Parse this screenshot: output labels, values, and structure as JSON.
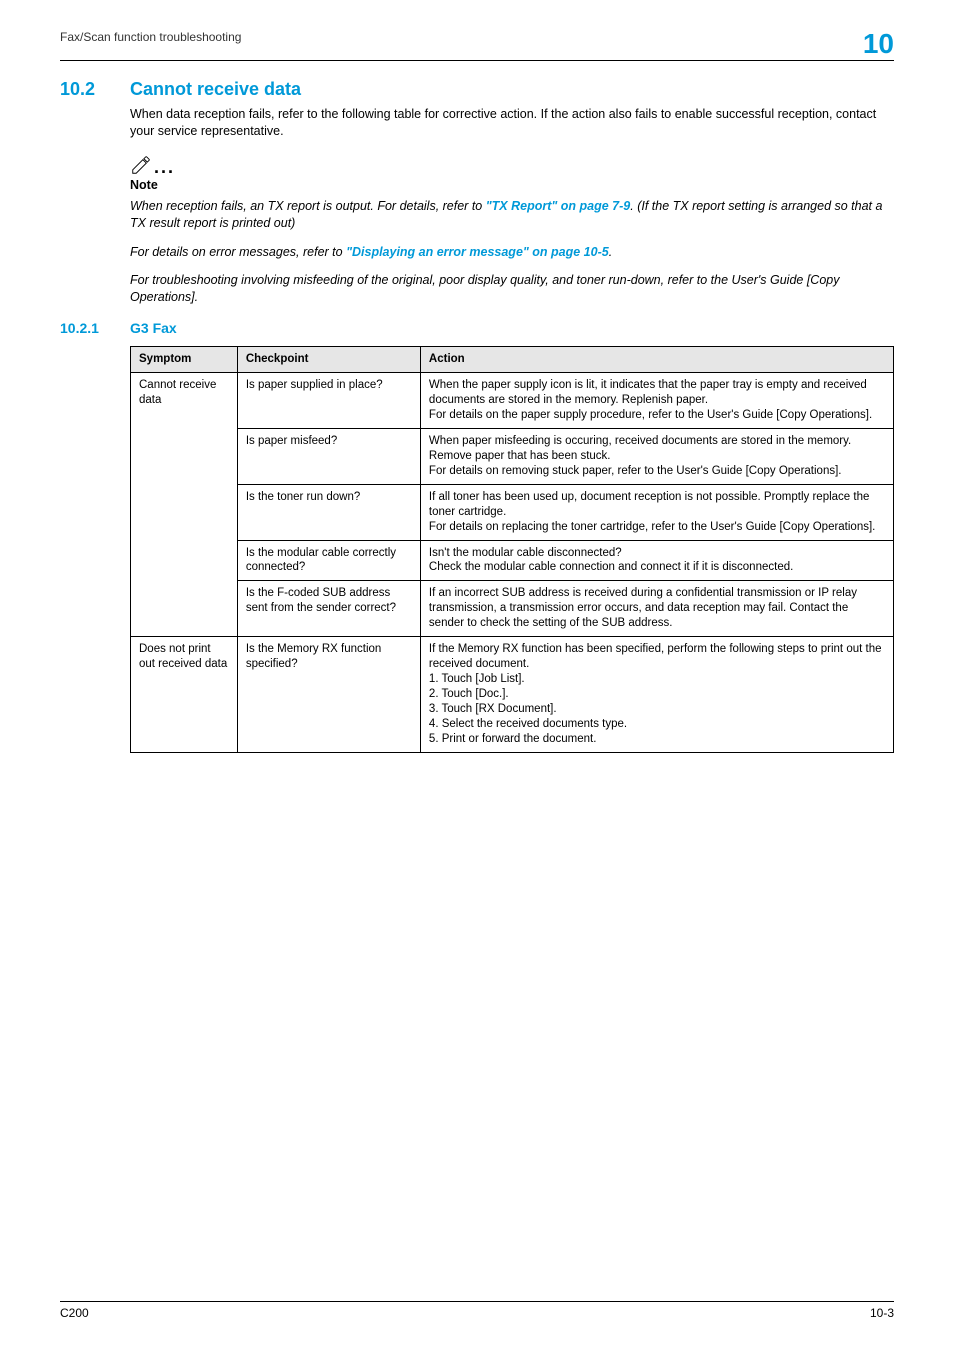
{
  "header": {
    "left": "Fax/Scan function troubleshooting",
    "right": "10"
  },
  "section": {
    "num": "10.2",
    "title": "Cannot receive data",
    "intro": "When data reception fails, refer to the following table for corrective action. If the action also fails to enable successful reception, contact your service representative."
  },
  "note": {
    "label": "Note",
    "p1_a": "When reception fails, an TX report is output. For details, refer to ",
    "p1_link": "\"TX Report\" on page 7-9",
    "p1_b": ". (If the TX report setting is arranged so that a TX result report is printed out)",
    "p2_a": "For details on error messages, refer to ",
    "p2_link": "\"Displaying an error message\" on page 10-5",
    "p2_b": ".",
    "p3": "For troubleshooting involving misfeeding of the original, poor display quality, and toner run-down, refer to the User's Guide [Copy Operations]."
  },
  "subsection": {
    "num": "10.2.1",
    "title": "G3 Fax"
  },
  "table": {
    "headers": {
      "symptom": "Symptom",
      "checkpoint": "Checkpoint",
      "action": "Action"
    },
    "rows": [
      {
        "symptom": "Cannot receive data",
        "checkpoint": "Is paper supplied in place?",
        "action": "When the paper supply icon is lit, it indicates that the paper tray is empty and received documents are stored in the memory. Replenish paper.\nFor details on the paper supply procedure, refer to the User's Guide [Copy Operations].",
        "symptom_rowspan": 5
      },
      {
        "checkpoint": "Is paper misfeed?",
        "action": "When paper misfeeding is occuring, received documents are stored in the memory.\nRemove paper that has been stuck.\nFor details on removing stuck paper, refer to the User's Guide [Copy Operations]."
      },
      {
        "checkpoint": "Is the toner run down?",
        "action": "If all toner has been used up, document reception is not possible. Promptly replace the toner cartridge.\nFor details on replacing the toner cartridge, refer to the User's Guide [Copy Operations]."
      },
      {
        "checkpoint": "Is the modular cable correctly connected?",
        "action": "Isn't the modular cable disconnected?\nCheck the modular cable connection and connect it if it is disconnected."
      },
      {
        "checkpoint": "Is the F-coded SUB address sent from the sender correct?",
        "action": "If an incorrect SUB address is received during a confidential transmission or IP relay transmission, a transmission error occurs, and data reception may fail. Contact the sender to check the setting of the SUB address."
      },
      {
        "symptom": "Does not print out received data",
        "checkpoint": "Is the Memory RX function specified?",
        "action": "If the Memory RX function has been specified, perform the following steps to print out the received document.\n1. Touch [Job List].\n2. Touch [Doc.].\n3. Touch [RX Document].\n4. Select the received documents type.\n5. Print or forward the document."
      }
    ]
  },
  "footer": {
    "left": "C200",
    "right": "10-3"
  }
}
